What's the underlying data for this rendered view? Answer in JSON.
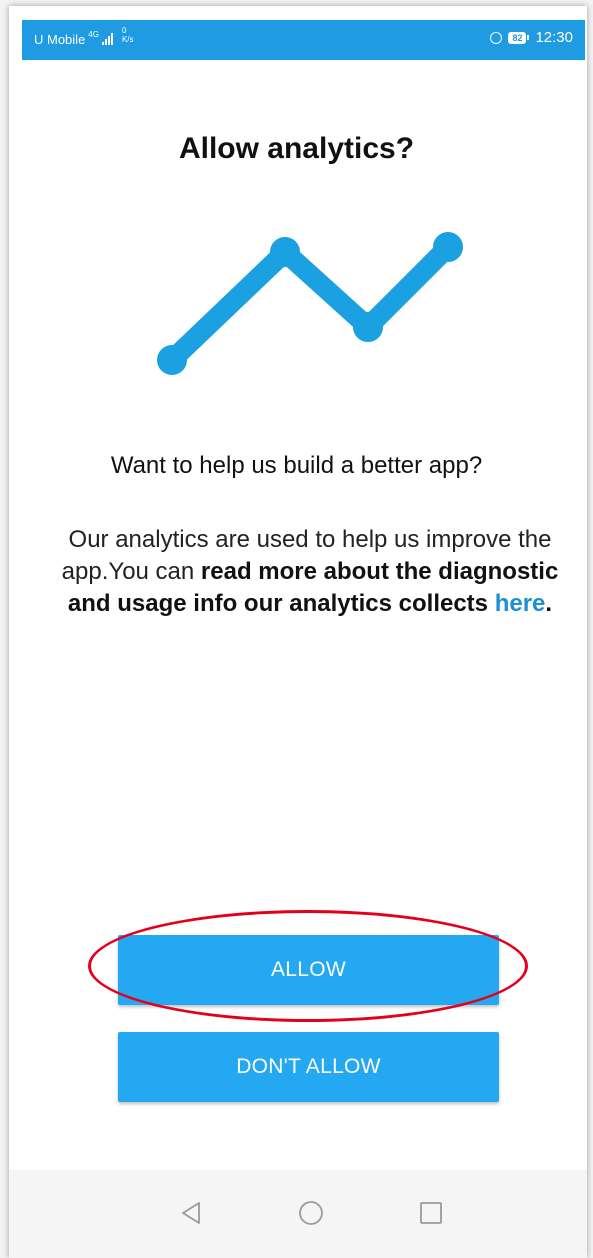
{
  "status_bar": {
    "carrier": "U Mobile",
    "network_type": "4G",
    "speed_value": "0",
    "speed_unit": "K/s",
    "battery": "82",
    "time": "12:30",
    "icons": [
      "signal-icon",
      "alarm-icon",
      "battery-icon"
    ]
  },
  "dialog": {
    "title": "Allow analytics?",
    "graphic": "analytics-line-chart-icon",
    "question": "Want to help us build a better app?",
    "description_text": "Our analytics are used to help us improve the app.You can ",
    "description_bold": "read more about the diagnostic and usage info our analytics collects ",
    "description_link": "here",
    "description_end": "."
  },
  "buttons": {
    "allow_label": "ALLOW",
    "deny_label": "DON'T ALLOW"
  },
  "nav_bar": {
    "icons": [
      "back-icon",
      "home-icon",
      "recents-icon"
    ]
  },
  "colors": {
    "accent": "#25a8f2",
    "status_bar": "#1e9be3",
    "link": "#1e8fd6",
    "highlight": "#e3001b"
  }
}
